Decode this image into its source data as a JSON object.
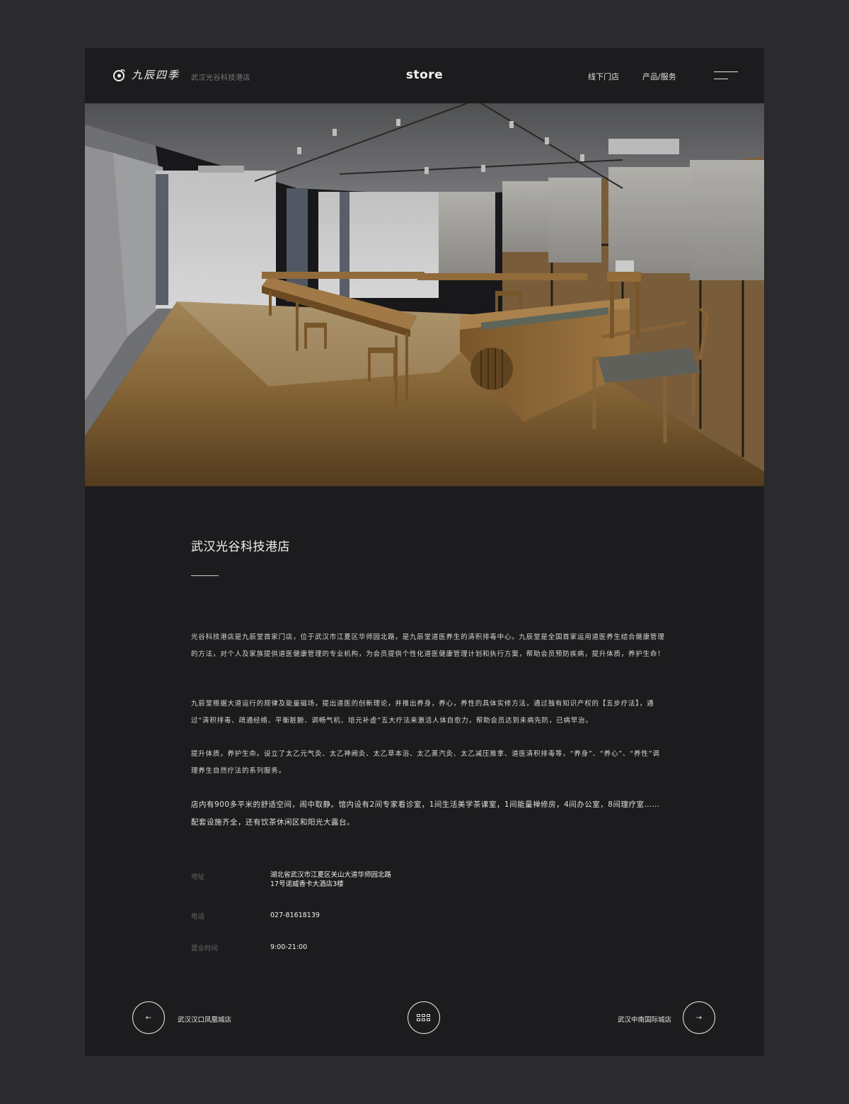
{
  "header": {
    "logo_text": "九辰四季",
    "store_subtitle": "武汉光谷科技港店",
    "title": "store",
    "nav": [
      "线下门店",
      "产品/服务"
    ]
  },
  "hero": {
    "image_alt": "tea room interior photo"
  },
  "store": {
    "name": "武汉光谷科技港店",
    "paragraphs": [
      "光谷科技港店是九辰堂首家门店，位于武汉市江夏区华师园北路，是九辰堂道医养生的清积排毒中心。九辰堂是全国首家运用道医养生结合健康管理的方法，对个人及家族提供道医健康管理的专业机构，为会员提供个性化道医健康管理计划和执行方案，帮助会员预防疾病，提升体质，养护生命！",
      "九辰堂根据大道运行的规律及能量磁场，提出道医的创新理论，并推出养身，养心，养性的具体实修方法，通过独有知识产权的【五步疗法】，通过“清积排毒、疏通经络、平衡脏腑、调畅气机、培元补虚”五大疗法来激活人体自愈力，帮助会员达到未病先防，已病早治。",
      "提升体质，养护生命。设立了太乙元气灸、太乙神阙灸、太乙草本浴、太乙蒸汽灸、太乙减压推拿、道医清积排毒等，“养身”、“养心”、“养性”调理养生自然疗法的系列服务。",
      "店内有900多平米的舒适空间，闹中取静。馆内设有2间专家看诊室，1间生活美学茶课室，1间能量禅修房，4间办公室，8间理疗室……配套设施齐全，还有饮茶休闲区和阳光大露台。"
    ],
    "info": {
      "address_label": "地址",
      "address_line1": "湖北省武汉市江夏区关山大道华师园北路",
      "address_line2": "17号诺威香卡大酒店3楼",
      "phone_label": "电话",
      "phone": "027-81618139",
      "hours_label": "营业时间",
      "hours": "9:00-21:00"
    }
  },
  "footer": {
    "prev_label": "武汉汉口凤凰城店",
    "next_label": "武汉中南国际城店",
    "prev_arrow": "←",
    "next_arrow": "→"
  },
  "colors": {
    "page_bg": "#2b2b2d",
    "frame_bg": "#1c1c1e",
    "text": "#e6e6e6",
    "muted": "#666668"
  }
}
